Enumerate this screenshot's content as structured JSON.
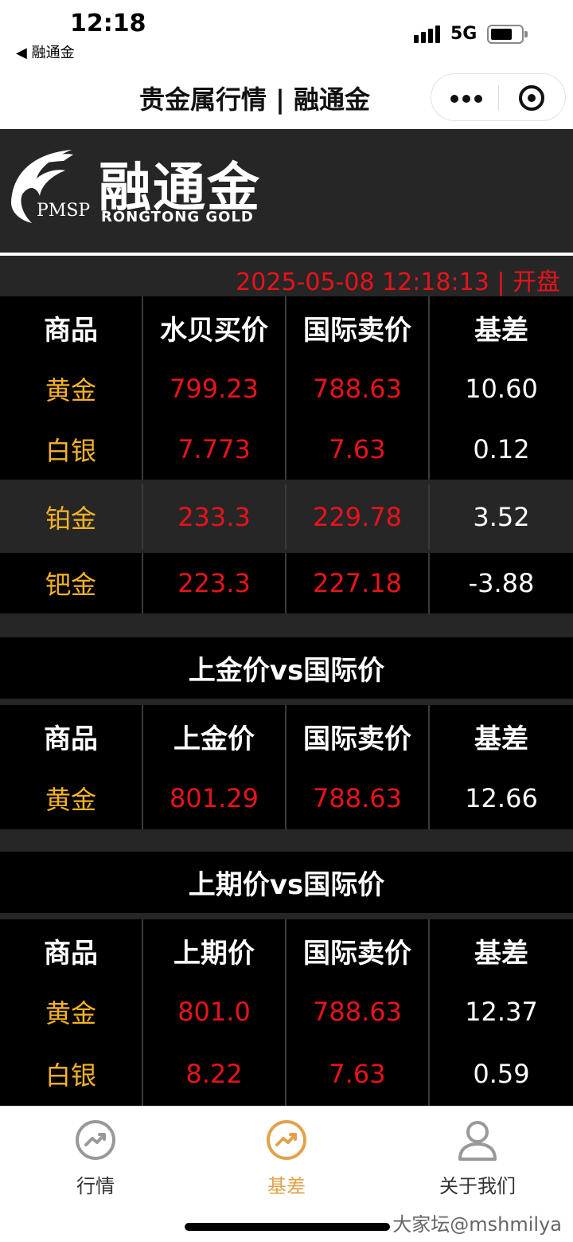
{
  "status_bar": {
    "time": "12:18",
    "back_app": "◀ 融通金",
    "network": "5G"
  },
  "title_bar": {
    "title": "贵金属行情 | 融通金"
  },
  "logo": {
    "cn": "融通金",
    "en": "RONGTONG   GOLD",
    "pmsp": "PMSP"
  },
  "timestamp": "2025-05-08 12:18:13 | 开盘",
  "table1": {
    "headers": [
      "商品",
      "水贝买价",
      "国际卖价",
      "基差"
    ],
    "rows": [
      [
        "黄金",
        "799.23",
        "788.63",
        "10.60"
      ],
      [
        "白银",
        "7.773",
        "7.63",
        "0.12"
      ],
      [
        "铂金",
        "233.3",
        "229.78",
        "3.52"
      ],
      [
        "钯金",
        "223.3",
        "227.18",
        "-3.88"
      ]
    ]
  },
  "section2": {
    "title": "上金价vs国际价",
    "headers": [
      "商品",
      "上金价",
      "国际卖价",
      "基差"
    ],
    "rows": [
      [
        "黄金",
        "801.29",
        "788.63",
        "12.66"
      ]
    ]
  },
  "section3": {
    "title": "上期价vs国际价",
    "headers": [
      "商品",
      "上期价",
      "国际卖价",
      "基差"
    ],
    "rows": [
      [
        "黄金",
        "801.0",
        "788.63",
        "12.37"
      ],
      [
        "白银",
        "8.22",
        "7.63",
        "0.59"
      ]
    ]
  },
  "nav": {
    "items": [
      {
        "label": "行情",
        "icon": "trend-icon",
        "active": false
      },
      {
        "label": "基差",
        "icon": "trend-icon",
        "active": true
      },
      {
        "label": "关于我们",
        "icon": "user-icon",
        "active": false
      }
    ]
  },
  "watermark": "大家坛@mshmilya",
  "colors": {
    "gold_text": "#f5b324",
    "price_red": "#e8131b",
    "dark_bg": "#262626",
    "active_tab": "#e2a24a"
  }
}
